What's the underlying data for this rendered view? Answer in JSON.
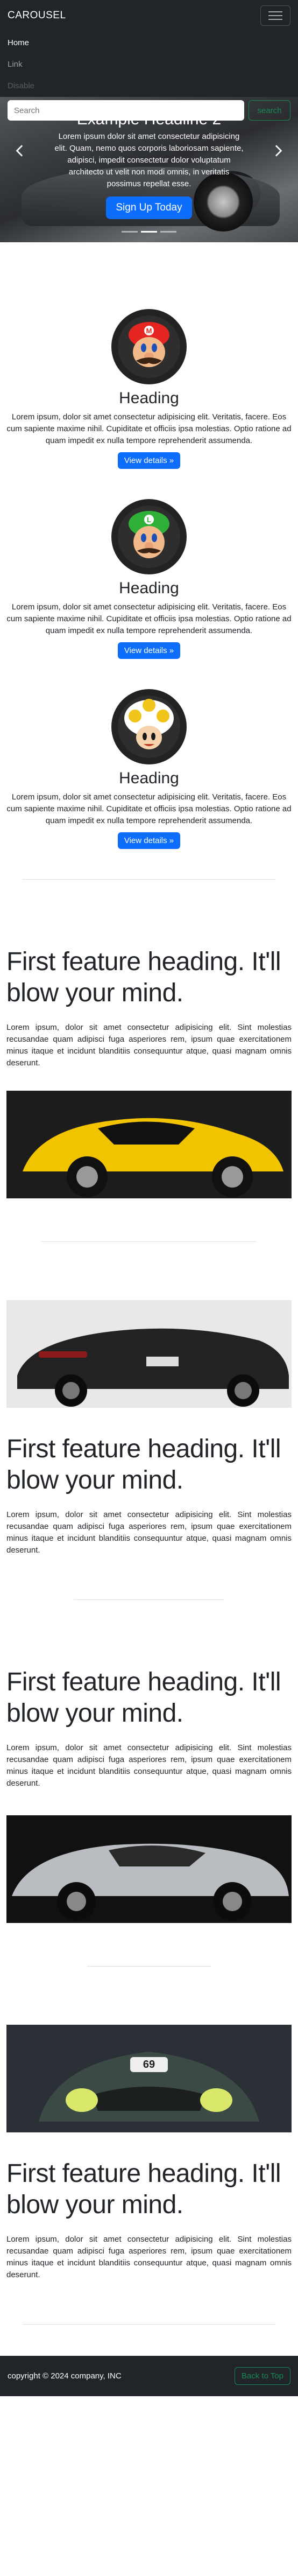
{
  "navbar": {
    "brand": "CAROUSEL",
    "links": [
      {
        "label": "Home",
        "state": "active"
      },
      {
        "label": "Link",
        "state": "normal"
      },
      {
        "label": "Disable",
        "state": "disabled"
      }
    ],
    "search_placeholder": "Search",
    "search_button": "search",
    "toggler_icon": "hamburger-icon"
  },
  "carousel": {
    "heading": "Example Headline 2",
    "text": "Lorem ipsum dolor sit amet consectetur adipisicing elit. Quam, nemo quos corporis laboriosam sapiente, adipisci, impedit consectetur dolor voluptatum architecto ut velit non modi omnis, in veritatis possimus repellat esse.",
    "button": "Sign Up Today",
    "prev_icon": "chevron-left-icon",
    "next_icon": "chevron-right-icon",
    "indicator_count": 3,
    "active_indicator": 2
  },
  "circles": [
    {
      "heading": "Heading",
      "image": "mario-icon",
      "text": "Lorem ipsum, dolor sit amet consectetur adipisicing elit. Veritatis, facere. Eos cum sapiente maxime nihil. Cupiditate et officiis ipsa molestias. Optio ratione ad quam impedit ex nulla tempore reprehenderit assumenda.",
      "button": "View details »"
    },
    {
      "heading": "Heading",
      "image": "luigi-icon",
      "text": "Lorem ipsum, dolor sit amet consectetur adipisicing elit. Veritatis, facere. Eos cum sapiente maxime nihil. Cupiditate et officiis ipsa molestias. Optio ratione ad quam impedit ex nulla tempore reprehenderit assumenda.",
      "button": "View details »"
    },
    {
      "heading": "Heading",
      "image": "toad-icon",
      "text": "Lorem ipsum, dolor sit amet consectetur adipisicing elit. Veritatis, facere. Eos cum sapiente maxime nihil. Cupiditate et officiis ipsa molestias. Optio ratione ad quam impedit ex nulla tempore reprehenderit assumenda.",
      "button": "View details »"
    }
  ],
  "features": [
    {
      "heading": "First feature heading. It'll blow your mind.",
      "text": "Lorem ipsum, dolor sit amet consectetur adipisicing elit. Sint molestias recusandae quam adipisci fuga asperiores rem, ipsum quae exercitationem minus itaque et incidunt blanditiis consequuntur atque, quasi magnam omnis deserunt.",
      "image": "yellow-sports-car-image"
    },
    {
      "heading": "First feature heading. It'll blow your mind.",
      "text": "Lorem ipsum, dolor sit amet consectetur adipisicing elit. Sint molestias recusandae quam adipisci fuga asperiores rem, ipsum quae exercitationem minus itaque et incidunt blanditiis consequuntur atque, quasi magnam omnis deserunt.",
      "image": "black-sports-car-image"
    },
    {
      "heading": "First feature heading. It'll blow your mind.",
      "text": "Lorem ipsum, dolor sit amet consectetur adipisicing elit. Sint molestias recusandae quam adipisci fuga asperiores rem, ipsum quae exercitationem minus itaque et incidunt blanditiis consequuntur atque, quasi magnam omnis deserunt.",
      "image": "silver-sports-car-image"
    },
    {
      "heading": "First feature heading. It'll blow your mind.",
      "text": "Lorem ipsum, dolor sit amet consectetur adipisicing elit. Sint molestias recusandae quam adipisci fuga asperiores rem, ipsum quae exercitationem minus itaque et incidunt blanditiis consequuntur atque, quasi magnam omnis deserunt.",
      "image": "green-race-car-image"
    }
  ],
  "footer": {
    "copyright": "copyright © 2024 company, INC",
    "back_to_top": "Back to Top"
  },
  "colors": {
    "dark": "#212529",
    "primary": "#0d6efd",
    "success": "#198754"
  }
}
